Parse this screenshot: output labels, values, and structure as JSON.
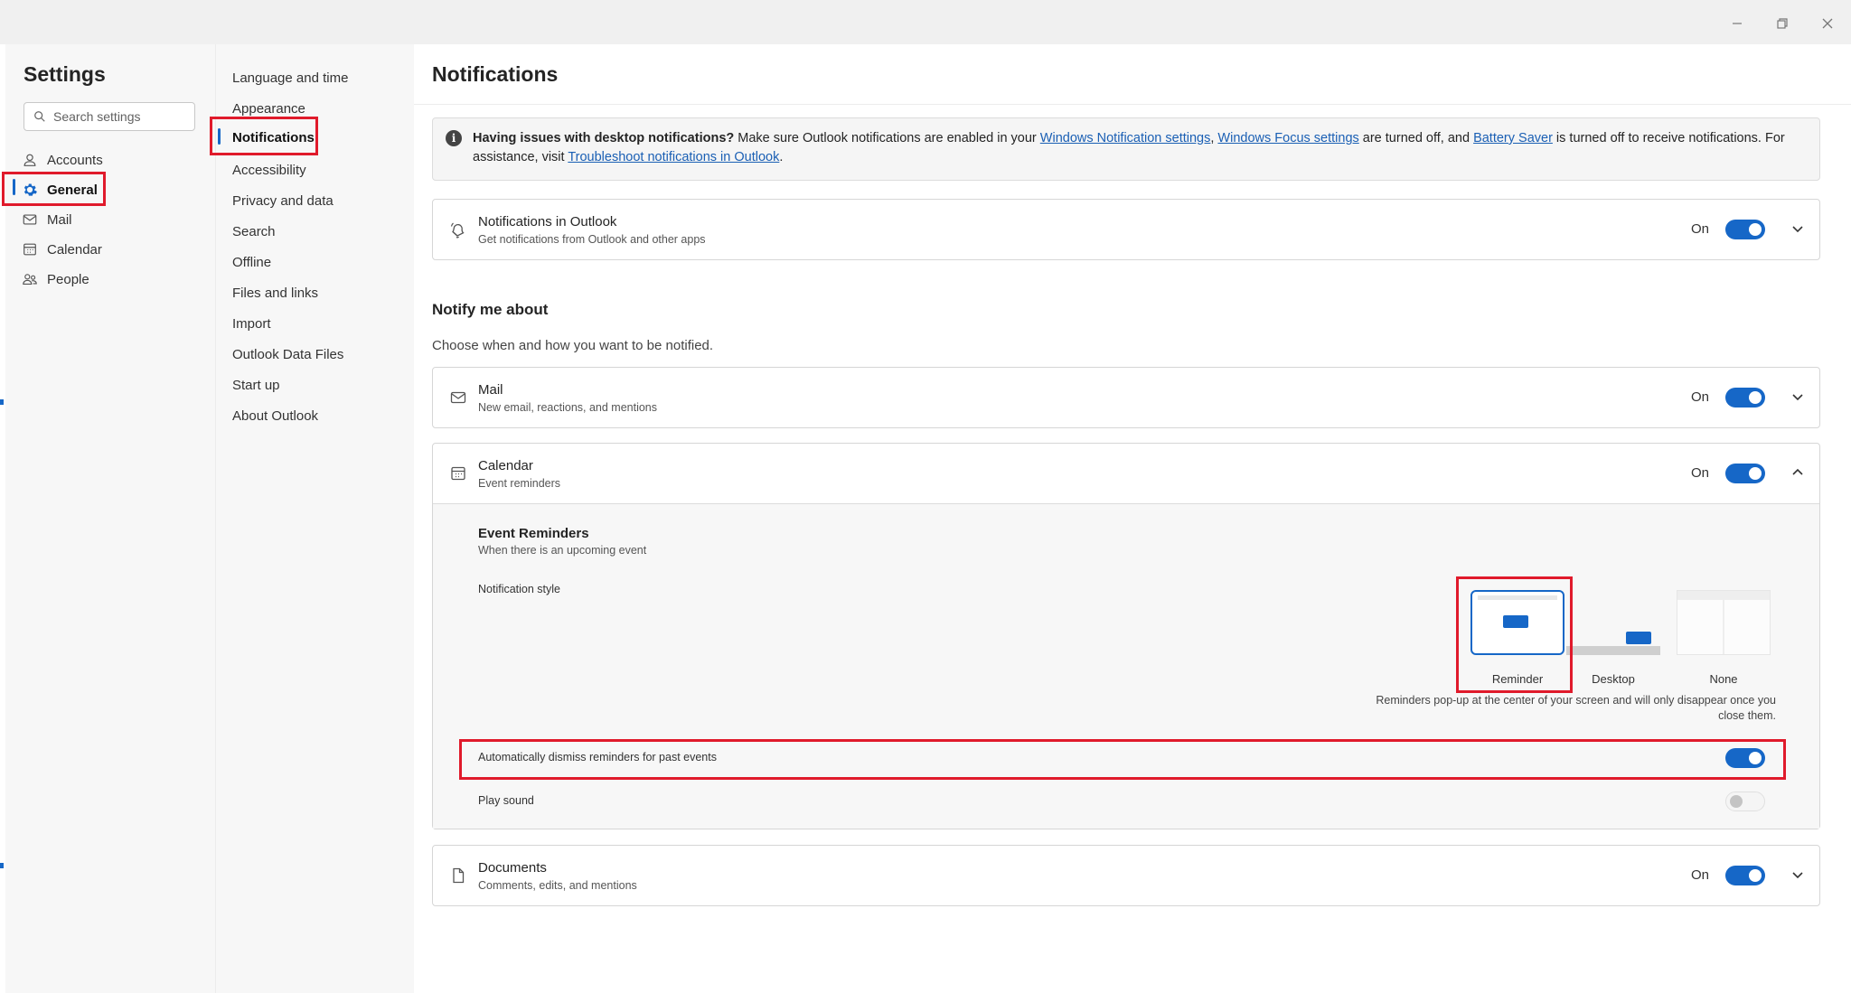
{
  "window": {
    "minimize_icon": "minimize-icon",
    "restore_icon": "restore-icon",
    "close_icon": "close-icon"
  },
  "settings": {
    "title": "Settings",
    "search_placeholder": "Search settings",
    "nav": [
      {
        "label": "Accounts",
        "icon": "person-icon"
      },
      {
        "label": "General",
        "icon": "gear-icon",
        "selected": true
      },
      {
        "label": "Mail",
        "icon": "mail-icon"
      },
      {
        "label": "Calendar",
        "icon": "calendar-icon"
      },
      {
        "label": "People",
        "icon": "people-icon"
      }
    ]
  },
  "general_nav": [
    {
      "label": "Language and time"
    },
    {
      "label": "Appearance"
    },
    {
      "label": "Notifications",
      "selected": true
    },
    {
      "label": "Accessibility"
    },
    {
      "label": "Privacy and data"
    },
    {
      "label": "Search"
    },
    {
      "label": "Offline"
    },
    {
      "label": "Files and links"
    },
    {
      "label": "Import"
    },
    {
      "label": "Outlook Data Files"
    },
    {
      "label": "Start up"
    },
    {
      "label": "About Outlook"
    }
  ],
  "page": {
    "title": "Notifications",
    "info": {
      "bold": "Having issues with desktop notifications?",
      "t1": " Make sure Outlook notifications are enabled in your ",
      "link1": "Windows Notification settings",
      "t2": ", ",
      "link2": "Windows Focus settings",
      "t3": " are turned off, and ",
      "link3": "Battery Saver",
      "t4": " is turned off to receive notifications. For assistance, visit ",
      "link4": "Troubleshoot notifications in Outlook",
      "t5": "."
    },
    "outlook_card": {
      "title": "Notifications in Outlook",
      "subtitle": "Get notifications from Outlook and other apps",
      "state": "On"
    },
    "notify_title": "Notify me about",
    "notify_subtitle": "Choose when and how you want to be notified.",
    "mail_card": {
      "title": "Mail",
      "subtitle": "New email, reactions, and mentions",
      "state": "On"
    },
    "calendar_card": {
      "title": "Calendar",
      "subtitle": "Event reminders",
      "state": "On",
      "event_reminders_title": "Event Reminders",
      "event_reminders_sub": "When there is an upcoming event",
      "style_label": "Notification style",
      "styles": [
        {
          "label": "Reminder",
          "selected": true
        },
        {
          "label": "Desktop"
        },
        {
          "label": "None"
        }
      ],
      "style_desc": "Reminders pop-up at the center of your screen and will only disappear once you close them.",
      "auto_dismiss": "Automatically dismiss reminders for past events",
      "play_sound": "Play sound"
    },
    "documents_card": {
      "title": "Documents",
      "subtitle": "Comments, edits, and mentions",
      "state": "On"
    }
  },
  "colors": {
    "accent": "#1667c7",
    "highlight": "#e01a2b"
  }
}
